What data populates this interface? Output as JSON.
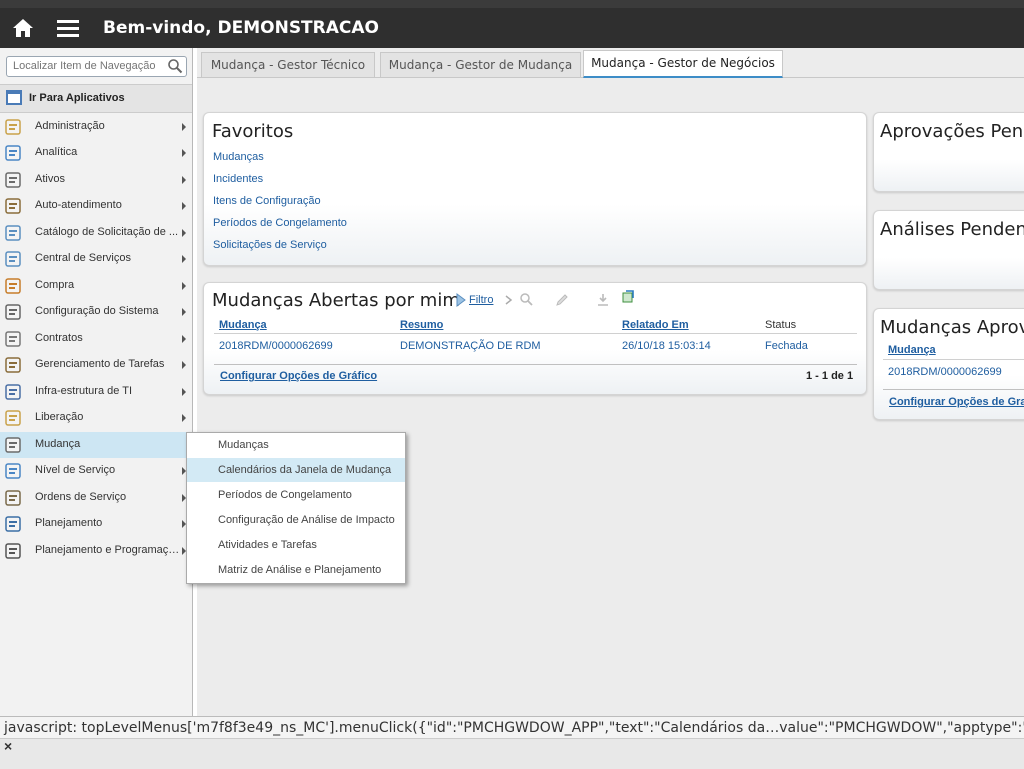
{
  "header": {
    "welcome": "Bem-vindo, DEMONSTRACAO"
  },
  "sidebar": {
    "search_placeholder": "Localizar Item de Navegação",
    "goto_apps": "Ir Para Aplicativos",
    "items": [
      {
        "label": "Administração",
        "icon": "admin-icon"
      },
      {
        "label": "Analítica",
        "icon": "analytics-icon"
      },
      {
        "label": "Ativos",
        "icon": "assets-icon"
      },
      {
        "label": "Auto-atendimento",
        "icon": "cart-icon"
      },
      {
        "label": "Catálogo de Solicitação de ...",
        "icon": "catalog-icon"
      },
      {
        "label": "Central de Serviços",
        "icon": "service-bell-icon"
      },
      {
        "label": "Compra",
        "icon": "purchase-icon"
      },
      {
        "label": "Configuração do Sistema",
        "icon": "system-config-icon"
      },
      {
        "label": "Contratos",
        "icon": "contracts-icon"
      },
      {
        "label": "Gerenciamento de Tarefas",
        "icon": "tasks-icon"
      },
      {
        "label": "Infra-estrutura de TI",
        "icon": "computer-icon"
      },
      {
        "label": "Liberação",
        "icon": "release-icon"
      },
      {
        "label": "Mudança",
        "icon": "change-icon"
      },
      {
        "label": "Nível de Serviço",
        "icon": "service-level-icon"
      },
      {
        "label": "Ordens de Serviço",
        "icon": "work-order-icon"
      },
      {
        "label": "Planejamento",
        "icon": "planning-icon"
      },
      {
        "label": "Planejamento e Programação",
        "icon": "scheduling-icon"
      }
    ]
  },
  "flyout": {
    "items": [
      "Mudanças",
      "Calendários da Janela de Mudança",
      "Períodos de Congelamento",
      "Configuração de Análise de Impacto",
      "Atividades e Tarefas",
      "Matriz de Análise e Planejamento"
    ]
  },
  "tabs": [
    "Mudança - Gestor Técnico",
    "Mudança - Gestor de Mudança",
    "Mudança - Gestor de Negócios"
  ],
  "favorites": {
    "title": "Favoritos",
    "links": [
      "Mudanças",
      "Incidentes",
      "Itens de Configuração",
      "Períodos de Congelamento",
      "Solicitações de Serviço"
    ]
  },
  "open_changes": {
    "title": "Mudanças Abertas por mim",
    "filter_label": "Filtro",
    "columns": [
      "Mudança",
      "Resumo",
      "Relatado Em",
      "Status"
    ],
    "rows": [
      [
        "2018RDM/0000062699",
        "DEMONSTRAÇÃO DE RDM",
        "26/10/18 15:03:14",
        "Fechada"
      ]
    ],
    "configure": "Configurar Opções de Gráfico",
    "pager": "1 - 1 de 1"
  },
  "right_cards": {
    "approvals_title": "Aprovações Pende",
    "reviews_title": "Análises Pendente",
    "approved_title": "Mudanças Aprova",
    "approved_column": "Mudança",
    "approved_row": "2018RDM/0000062699",
    "approved_configure": "Configurar Opções de Gra"
  },
  "statusbar": "javascript: topLevelMenus['m7f8f3e49_ns_MC'].menuClick({\"id\":\"PMCHGWDOW_APP\",\"text\":\"Calendários da…value\":\"PMCHGWDOW\",\"apptype\":\"RU"
}
